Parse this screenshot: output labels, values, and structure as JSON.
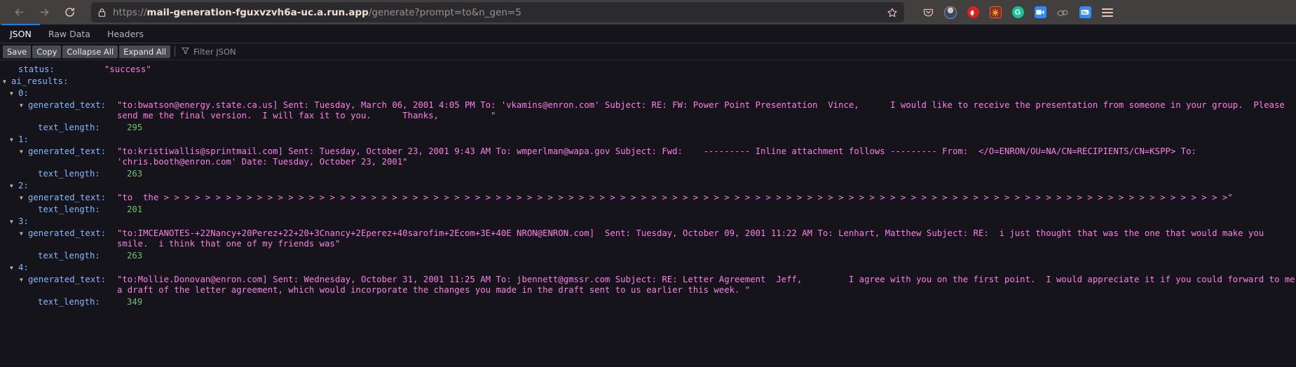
{
  "browser": {
    "back_label": "Back",
    "forward_label": "Forward",
    "reload_label": "Reload",
    "lock_icon": "lock-icon",
    "url_prefix": "https://",
    "url_domain": "mail-generation-fguxvzvh6a-uc.a.run.app",
    "url_path": "/generate?prompt=to&n_gen=5",
    "url_full": "https://mail-generation-fguxvzvh6a-uc.a.run.app/generate?prompt=to&n_gen=5",
    "bookmark_label": "Bookmark this page",
    "extensions": [
      {
        "name": "pocket-icon",
        "label": "Pocket"
      },
      {
        "name": "account-avatar",
        "label": "Account"
      },
      {
        "name": "ublock-origin-icon",
        "label": "uBlock Origin"
      },
      {
        "name": "extension-gear-icon",
        "label": "Extension"
      },
      {
        "name": "grammarly-icon",
        "label": "G"
      },
      {
        "name": "zoom-icon",
        "label": "Zoom"
      },
      {
        "name": "clouds-icon",
        "label": "Extension"
      },
      {
        "name": "card-icon",
        "label": "Card"
      },
      {
        "name": "app-menu-icon",
        "label": "Open application menu"
      }
    ]
  },
  "viewer": {
    "tabs": [
      {
        "label": "JSON",
        "active": true
      },
      {
        "label": "Raw Data",
        "active": false
      },
      {
        "label": "Headers",
        "active": false
      }
    ],
    "toolbar": {
      "save": "Save",
      "copy": "Copy",
      "collapse_all": "Collapse All",
      "expand_all": "Expand All",
      "filter_placeholder": "Filter JSON",
      "filter_icon": "filter-icon"
    }
  },
  "json": {
    "status_key": "status:",
    "status_value": "\"success\"",
    "ai_results_key": "ai_results:",
    "generated_text_key": "generated_text:",
    "text_length_key": "text_length:",
    "results": [
      {
        "index": "0:",
        "generated_text": "\"to:bwatson@energy.state.ca.us] Sent: Tuesday, March 06, 2001 4:05 PM To: 'vkamins@enron.com' Subject: RE: FW: Power Point Presentation  Vince,      I would like to receive the presentation from someone in your group.  Please send me the final version.  I will fax it to you.      Thanks,          \"",
        "text_length": "295"
      },
      {
        "index": "1:",
        "generated_text": "\"to:kristiwallis@sprintmail.com] Sent: Tuesday, October 23, 2001 9:43 AM To: wmperlman@wapa.gov Subject: Fwd:    --------- Inline attachment follows --------- From:  </O=ENRON/OU=NA/CN=RECIPIENTS/CN=KSPP> To: 'chris.booth@enron.com' Date: Tuesday, October 23, 2001\"",
        "text_length": "263"
      },
      {
        "index": "2:",
        "generated_text": "\"to  the > > > > > > > > > > > > > > > > > > > > > > > > > > > > > > > > > > > > > > > > > > > > > > > > > > > > > > > > > > > > > > > > > > > > > > > > > > > > > > > > > > > > > > > > > > > > > > > > > > > > > > >\"",
        "text_length": "201"
      },
      {
        "index": "3:",
        "generated_text": "\"to:IMCEANOTES-+22Nancy+20Perez+22+20+3Cnancy+2Eperez+40sarofim+2Ecom+3E+40E NRON@ENRON.com]  Sent: Tuesday, October 09, 2001 11:22 AM To: Lenhart, Matthew Subject: RE:  i just thought that was the one that would make you smile.  i think that one of my friends was\"",
        "text_length": "263"
      },
      {
        "index": "4:",
        "generated_text": "\"to:Mollie.Donovan@enron.com] Sent: Wednesday, October 31, 2001 11:25 AM To: jbennett@gmssr.com Subject: RE: Letter Agreement  Jeff,         I agree with you on the first point.  I would appreciate it if you could forward to me a draft of the letter agreement, which would incorporate the changes you made in the draft sent to us earlier this week. \"",
        "text_length": "349"
      }
    ]
  },
  "colors": {
    "chrome_bg": "#42403f",
    "url_bg": "#2b2a2f",
    "viewer_bg": "#14141a",
    "accent": "#0a84ff",
    "key_color": "#85b8fc",
    "string_color": "#ff7de9",
    "number_color": "#6ec26e"
  }
}
